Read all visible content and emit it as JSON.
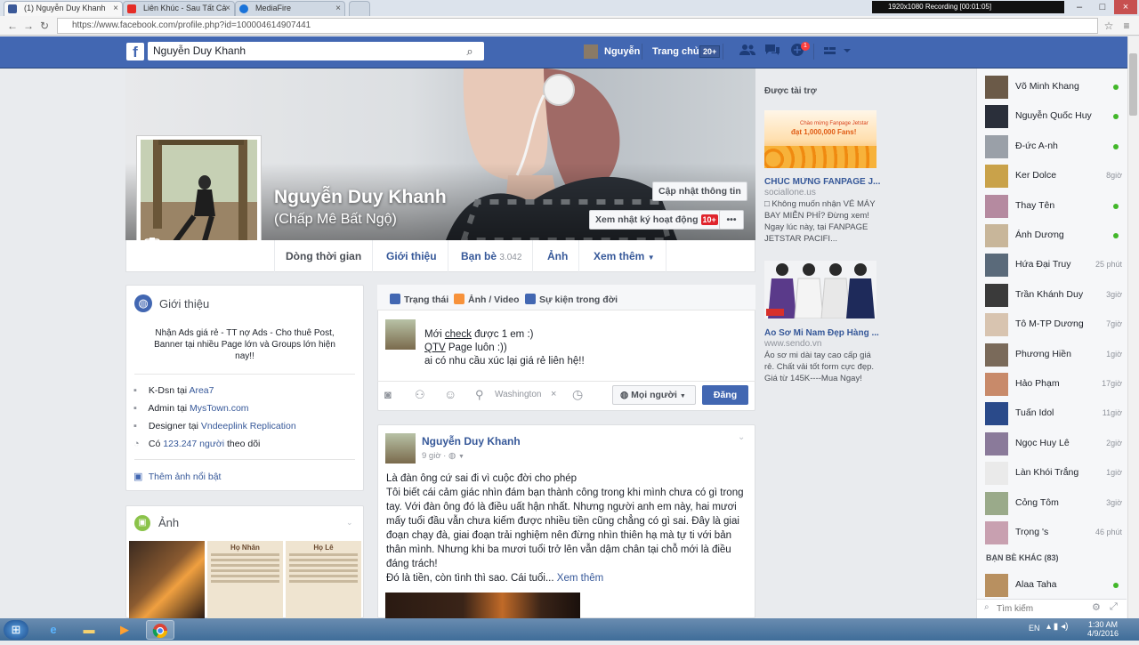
{
  "browser": {
    "tabs": [
      {
        "label": "(1) Nguyễn Duy Khanh",
        "active": true,
        "icon": "facebook-icon",
        "color": "#3b5998"
      },
      {
        "label": "Liên Khúc - Sau Tất Cả",
        "active": false,
        "icon": "youtube-icon",
        "color": "#e52d27"
      },
      {
        "label": "MediaFire",
        "active": false,
        "icon": "mediafire-icon",
        "color": "#1a73d9"
      }
    ],
    "recording_text": "1920x1080     Recording [00:01:05]",
    "url": "https://www.facebook.com/profile.php?id=100004614907441"
  },
  "header": {
    "search_value": "Nguyễn Duy Khanh",
    "user_name": "Nguyễn",
    "home_label": "Trang chủ",
    "home_badge": "20+",
    "notifications_badge": "1",
    "brand_color": "#4267b2"
  },
  "profile": {
    "name": "Nguyễn Duy Khanh",
    "alternate_name": "(Chấp Mê Bất Ngộ)",
    "update_info_button": "Cập nhật thông tin",
    "activity_log_button": "Xem nhật ký hoạt động",
    "activity_log_badge": "10+",
    "more_button": "•••"
  },
  "tabs": [
    {
      "label": "Dòng thời gian",
      "count": ""
    },
    {
      "label": "Giới thiệu",
      "count": ""
    },
    {
      "label": "Bạn bè",
      "count": "3.042"
    },
    {
      "label": "Ảnh",
      "count": ""
    },
    {
      "label": "Xem thêm",
      "count": ""
    }
  ],
  "intro": {
    "title": "Giới thiệu",
    "bio": "Nhận Ads giá rẻ - TT nợ Ads - Cho thuê Post, Banner tại nhiều Page lớn và Groups lớn hiện nay!!",
    "rows": [
      {
        "prefix": "K-Dsn tại ",
        "link": "Area7",
        "suffix": "",
        "icon": "briefcase-icon"
      },
      {
        "prefix": "Admin tại ",
        "link": "MysTown.com",
        "suffix": "",
        "icon": "briefcase-icon"
      },
      {
        "prefix": "Designer tại ",
        "link": "Vndeeplink Replication",
        "suffix": "",
        "icon": "briefcase-icon"
      },
      {
        "prefix": "Có ",
        "link": "123.247 người",
        "suffix": " theo dõi",
        "icon": "rss-icon"
      }
    ],
    "featured_link": "Thêm ảnh nổi bật"
  },
  "photos": {
    "title": "Ảnh",
    "thumb_labels": [
      "Họ Nhân",
      "Họ Lê"
    ]
  },
  "composer": {
    "tabs": [
      "Trạng thái",
      "Ảnh / Video",
      "Sự kiện trong đời"
    ],
    "text_line1_a": "Mới ",
    "text_line1_link": "check",
    "text_line1_b": " được 1 em :)",
    "text_line2_link": "QTV",
    "text_line2_b": " Page luôn :))",
    "text_line3": "ai có nhu cầu xúc lại giá rẻ liên hệ!!",
    "location": "Washington",
    "audience": "Mọi người",
    "post_button": "Đăng"
  },
  "post": {
    "author": "Nguyễn Duy Khanh",
    "time": "9 giờ",
    "paragraphs": [
      "Là đàn ông cứ sai đi vì cuộc đời cho phép",
      "Tôi biết cái cảm giác nhìn đám bạn thành công trong khi mình chưa có gì trong tay. Với đàn ông đó là điều uất hận nhất. Nhưng người anh em này, hai mươi mấy tuổi đầu vẫn chưa kiếm được nhiều tiền cũng chẳng có gì sai. Đây là giai đoạn chạy đà, giai đoạn trải nghiệm nên đừng nhìn thiên hạ mà tự ti với bản thân mình. Nhưng khi ba mươi tuổi trở lên vẫn dậm chân tại chỗ mới là điều đáng trách!",
      "Đó là tiền, còn tình thì sao. Cái tuổi..."
    ],
    "see_more": "Xem thêm"
  },
  "ads": {
    "header": "Được tài trợ",
    "items": [
      {
        "banner_line1": "Chào mừng Fanpage Jetstar",
        "banner_line2": "đạt 1,000,000 Fans!",
        "title": "CHÚC MỪNG FANPAGE J...",
        "url": "sociallone.us",
        "desc": "□ Không muốn nhận VÉ MÁY BAY MIỄN PHÍ? Đừng xem! Ngay lúc này, tại FANPAGE JETSTAR PACIFI..."
      },
      {
        "banner_line1": "",
        "banner_line2": "",
        "title": "Áo Sơ Mi Nam Đẹp Hàng ...",
        "url": "www.sendo.vn",
        "desc": "Áo sơ mi dài tay cao cấp giá rẻ. Chất vải tốt form cực đẹp. Giá từ 145K----Mua Ngay!"
      }
    ]
  },
  "chat": {
    "contacts": [
      {
        "name": "Võ Minh Khang",
        "status": "",
        "online": true,
        "color": "#6b5a48"
      },
      {
        "name": "Nguyễn Quốc Huy",
        "status": "",
        "online": true,
        "color": "#2a2f3a"
      },
      {
        "name": "Đ-ức A-nh",
        "status": "",
        "online": true,
        "color": "#9aa0a8"
      },
      {
        "name": "Ker Dolce",
        "status": "8giờ",
        "online": false,
        "color": "#c9a24a"
      },
      {
        "name": "Thay Tên",
        "status": "",
        "online": true,
        "color": "#b58aa0"
      },
      {
        "name": "Ánh Dương",
        "status": "",
        "online": true,
        "color": "#c8b69a"
      },
      {
        "name": "Hứa Đại Truy",
        "status": "25 phút",
        "online": false,
        "color": "#5a6a7a"
      },
      {
        "name": "Trần Khánh Duy",
        "status": "3giờ",
        "online": false,
        "color": "#3a3a3a"
      },
      {
        "name": "Tô M-TP Dương",
        "status": "7giờ",
        "online": false,
        "color": "#d8c4b0"
      },
      {
        "name": "Phương Hiền",
        "status": "1giờ",
        "online": false,
        "color": "#7a6a5a"
      },
      {
        "name": "Hảo Phạm",
        "status": "17giờ",
        "online": false,
        "color": "#c88a6a"
      },
      {
        "name": "Tuấn Idol",
        "status": "11giờ",
        "online": false,
        "color": "#2a4a8a"
      },
      {
        "name": "Ngọc Huy Lê",
        "status": "2giờ",
        "online": false,
        "color": "#8a7a9a"
      },
      {
        "name": "Làn Khói Trắng",
        "status": "1giờ",
        "online": false,
        "color": "#eaeaea"
      },
      {
        "name": "Cỏng Tôm",
        "status": "3giờ",
        "online": false,
        "color": "#9aaa8a"
      },
      {
        "name": "Trọng 's",
        "status": "46 phút",
        "online": false,
        "color": "#c8a0b0"
      }
    ],
    "other_friends_header": "BẠN BÈ KHÁC (83)",
    "other_friends": [
      {
        "name": "Alaa Taha",
        "status": "",
        "online": true,
        "color": "#b89060"
      }
    ],
    "search_placeholder": "Tìm kiếm"
  },
  "taskbar": {
    "language": "EN",
    "time": "1:30 AM",
    "date": "4/9/2016"
  }
}
